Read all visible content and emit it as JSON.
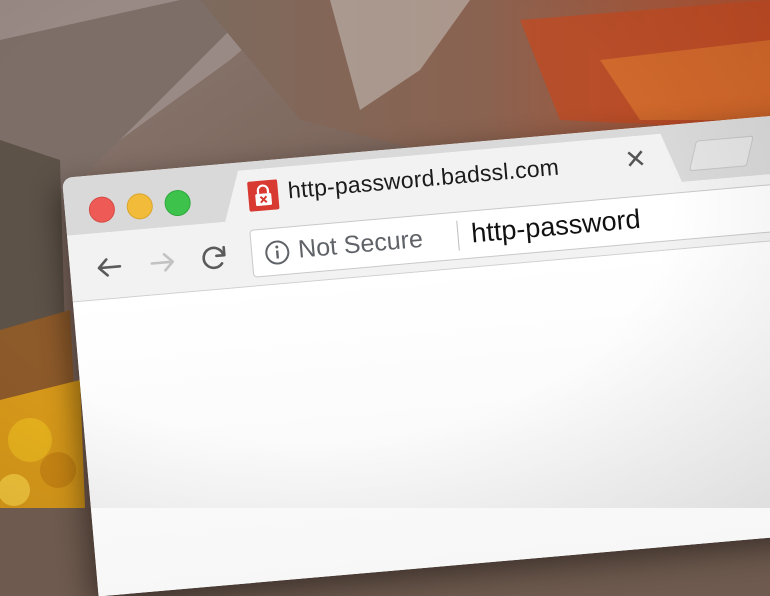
{
  "tab": {
    "title": "http-password.badssl.com",
    "favicon": "lock-warning-icon",
    "close_icon": "close-icon",
    "favicon_color": "#d83a32"
  },
  "toolbar": {
    "back_icon": "arrow-left-icon",
    "forward_icon": "arrow-right-icon",
    "reload_icon": "reload-icon"
  },
  "omnibox": {
    "security_icon": "info-icon",
    "security_label": "Not Secure",
    "url": "http-password"
  },
  "window_controls": {
    "close_color": "#ee5a55",
    "minimize_color": "#f2bc3a",
    "zoom_color": "#3dc24c"
  }
}
